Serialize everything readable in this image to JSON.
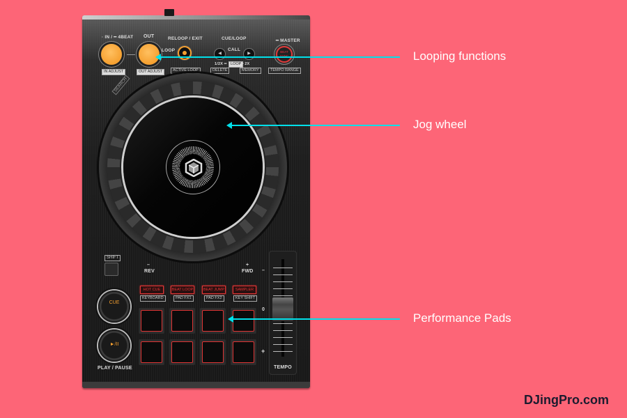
{
  "device": {
    "top_controls": {
      "in_label": "· IN / ━ 4BEAT",
      "out_label": "OUT",
      "in_adjust": "IN ADJUST",
      "out_adjust": "OUT ADJUST",
      "loop_label": "LOOP",
      "reloop_label": "RELOOP / EXIT",
      "active_loop": "ACTIVE LOOP",
      "cue_loop_label": "CUE/LOOP",
      "call_label": "CALL",
      "loop_size": "1/2X ━",
      "loop_tag": "LOOP",
      "loop_size_2x": "━ 2X",
      "delete": "DELETE",
      "memory": "MEMORY",
      "master_label": "━ MASTER",
      "beat_sync": "BEAT SYNC",
      "tempo_range": "TEMPO RANGE",
      "left_arrow": "◀",
      "right_arrow": "▶"
    },
    "jog": {
      "search_label": "SEARCH"
    },
    "shift_label": "SHIFT",
    "rev_label": "REV",
    "fwd_label": "FWD",
    "rev_sign": "–",
    "fwd_sign": "+",
    "cue_label": "CUE",
    "play_label": "►/II",
    "play_pause_label": "PLAY / PAUSE",
    "mode_buttons": [
      {
        "label": "HOT CUE",
        "sub": "KEYBOARD"
      },
      {
        "label": "BEAT LOOP",
        "sub": "PAD FX1"
      },
      {
        "label": "BEAT JUMP",
        "sub": "PAD FX2"
      },
      {
        "label": "SAMPLER",
        "sub": "KEY SHIFT"
      }
    ],
    "pad_count": 8,
    "tempo": {
      "label": "TEMPO",
      "minus": "–",
      "zero": "0",
      "plus": "+",
      "position": 0.5
    }
  },
  "callouts": [
    {
      "label": "Looping functions"
    },
    {
      "label": "Jog wheel"
    },
    {
      "label": "Performance Pads"
    }
  ],
  "colors": {
    "background": "#fd6577",
    "callout_line": "#00e0ea",
    "pad_accent": "#e03434",
    "button_orange": "#f5a030"
  },
  "brand": "DJingPro.com"
}
